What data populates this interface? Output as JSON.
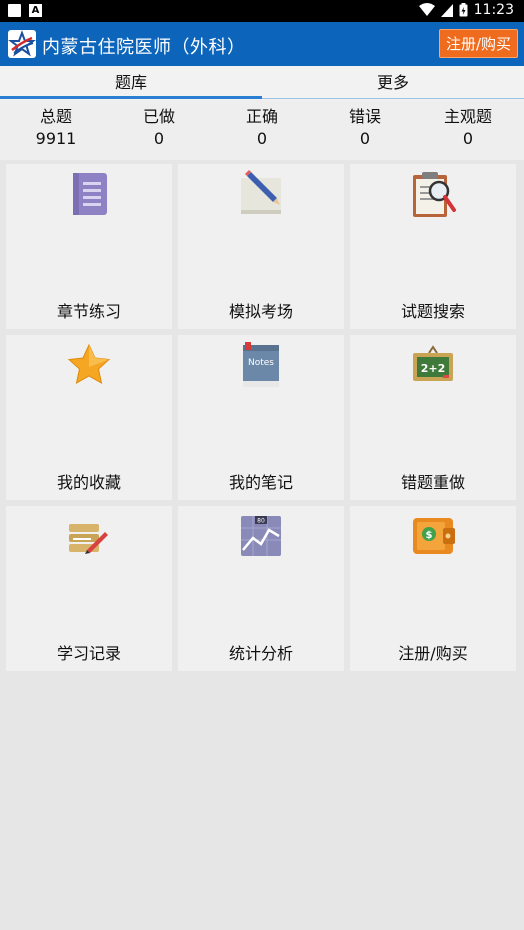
{
  "status": {
    "time": "11:23"
  },
  "app": {
    "title": "内蒙古住院医师（外科）",
    "register_label": "注册/购买"
  },
  "tabs": [
    {
      "label": "题库",
      "active": true
    },
    {
      "label": "更多",
      "active": false
    }
  ],
  "stats": [
    {
      "label": "总题",
      "value": "9911"
    },
    {
      "label": "已做",
      "value": "0"
    },
    {
      "label": "正确",
      "value": "0"
    },
    {
      "label": "错误",
      "value": "0"
    },
    {
      "label": "主观题",
      "value": "0"
    }
  ],
  "tiles": [
    {
      "label": "章节练习",
      "icon": "document-icon"
    },
    {
      "label": "模拟考场",
      "icon": "pencil-paper-icon"
    },
    {
      "label": "试题搜索",
      "icon": "clipboard-search-icon"
    },
    {
      "label": "我的收藏",
      "icon": "star-icon"
    },
    {
      "label": "我的笔记",
      "icon": "notes-icon",
      "icon_text": "Notes"
    },
    {
      "label": "错题重做",
      "icon": "chalkboard-icon",
      "icon_text": "2+2"
    },
    {
      "label": "学习记录",
      "icon": "record-icon"
    },
    {
      "label": "统计分析",
      "icon": "chart-icon",
      "icon_text": "80"
    },
    {
      "label": "注册/购买",
      "icon": "wallet-icon",
      "icon_text": "$"
    }
  ],
  "colors": {
    "app_bar": "#0c65bb",
    "register_button": "#ef6b1d",
    "tab_indicator": "#2b7fd0"
  }
}
